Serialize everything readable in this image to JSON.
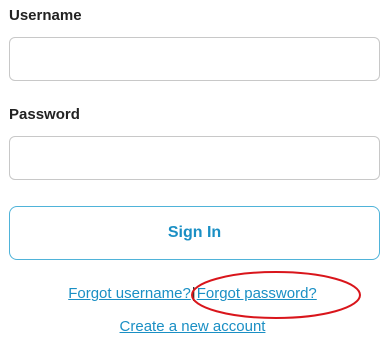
{
  "form": {
    "username_label": "Username",
    "username_value": "",
    "username_placeholder": "",
    "password_label": "Password",
    "password_value": "",
    "password_placeholder": "",
    "signin_label": "Sign In"
  },
  "links": {
    "forgot_username": "Forgot username?",
    "separator": "|",
    "forgot_password": "Forgot password?",
    "create_account": "Create a new account"
  },
  "colors": {
    "accent": "#1a8fc4",
    "button_border": "#4fb3d9",
    "annotation": "#d9151b"
  }
}
